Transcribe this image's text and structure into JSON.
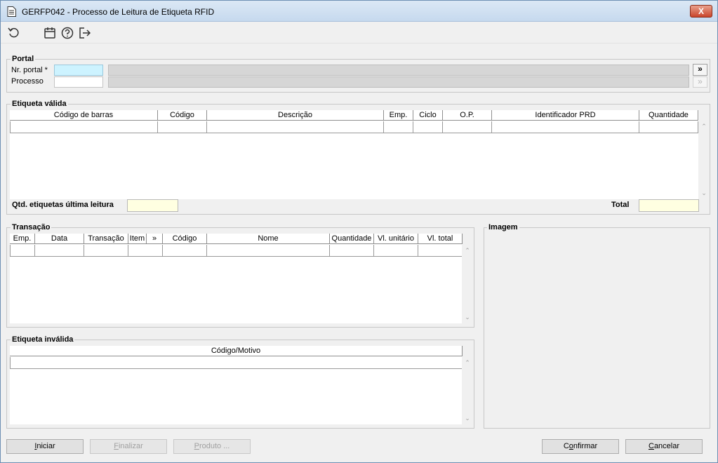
{
  "window": {
    "title": "GERFP042 - Processo de Leitura de Etiqueta RFID",
    "close_label": "X"
  },
  "toolbar": {
    "icons": [
      "refresh-icon",
      "calendar-icon",
      "help-icon",
      "exit-icon"
    ]
  },
  "portal": {
    "title": "Portal",
    "nr_portal_label": "Nr. portal *",
    "processo_label": "Processo",
    "nr_portal_value": "",
    "nr_portal_desc": "",
    "processo_value": "",
    "processo_desc": "",
    "lookup_label": "»"
  },
  "etiqueta_valida": {
    "title": "Etiqueta válida",
    "columns": [
      "Código de barras",
      "Código",
      "Descrição",
      "Emp.",
      "Ciclo",
      "O.P.",
      "Identificador PRD",
      "Quantidade"
    ],
    "qtd_label": "Qtd. etiquetas última leitura",
    "qtd_value": "",
    "total_label": "Total",
    "total_value": ""
  },
  "transacao": {
    "title": "Transação",
    "columns": [
      "Emp.",
      "Data",
      "Transação",
      "Item",
      "»",
      "Código",
      "Nome",
      "Quantidade",
      "Vl. unitário",
      "Vl. total"
    ]
  },
  "etiqueta_invalida": {
    "title": "Etiqueta inválida",
    "columns": [
      "Código/Motivo"
    ]
  },
  "imagem": {
    "title": "Imagem"
  },
  "buttons": {
    "iniciar": {
      "key": "I",
      "rest": "niciar"
    },
    "finalizar": {
      "key": "F",
      "rest": "inalizar"
    },
    "produto": {
      "key": "P",
      "rest": "roduto ..."
    },
    "confirmar": {
      "pre": "C",
      "key": "o",
      "rest": "nfirmar"
    },
    "cancelar": {
      "key": "C",
      "rest": "ancelar"
    }
  },
  "colors": {
    "required_field": "#cdf3ff",
    "readonly_field": "#d6d6d6",
    "total_field": "#ffffe1"
  }
}
